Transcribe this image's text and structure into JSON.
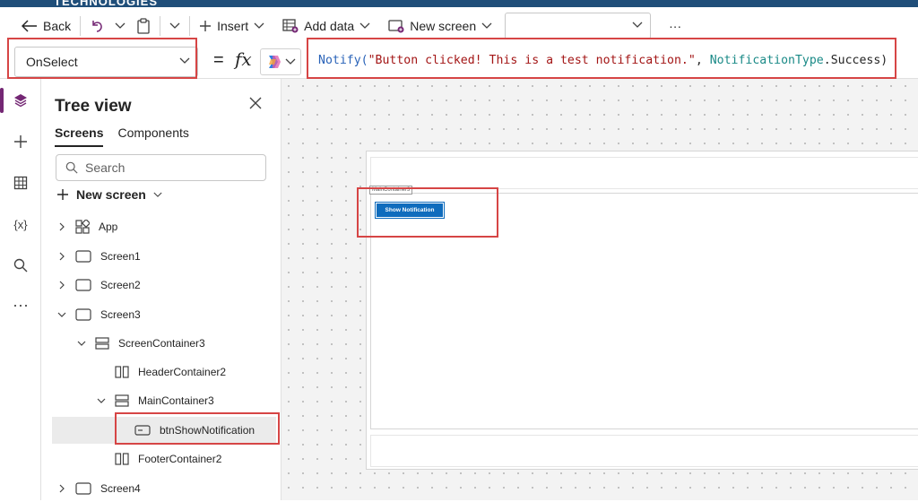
{
  "app_banner": "TECHNOLOGIES",
  "toolbar": {
    "back_label": "Back",
    "insert_label": "Insert",
    "add_data_label": "Add data",
    "new_screen_label": "New screen",
    "screen_dropdown_value": "",
    "more_label": "···"
  },
  "formula_bar": {
    "property": "OnSelect",
    "equals": "=",
    "fx": "fx",
    "code": {
      "fn": "Notify(",
      "str": "\"Button clicked! This is a test notification.\"",
      "sep": ", ",
      "enum": "NotificationType",
      "tail": ".Success)"
    }
  },
  "tree_view": {
    "title": "Tree view",
    "tabs": [
      "Screens",
      "Components"
    ],
    "search_placeholder": "Search",
    "new_screen_label": "New screen",
    "nodes": [
      {
        "label": "App"
      },
      {
        "label": "Screen1"
      },
      {
        "label": "Screen2"
      },
      {
        "label": "Screen3"
      },
      {
        "label": "ScreenContainer3"
      },
      {
        "label": "HeaderContainer2"
      },
      {
        "label": "MainContainer3"
      },
      {
        "label": "btnShowNotification"
      },
      {
        "label": "FooterContainer2"
      },
      {
        "label": "Screen4"
      }
    ]
  },
  "canvas": {
    "main_container_tag": "MainContainer3",
    "button_label": "Show Notification"
  },
  "colors": {
    "accent": "#742774",
    "highlight_box": "#d64545",
    "button": "#0f6cbd"
  }
}
